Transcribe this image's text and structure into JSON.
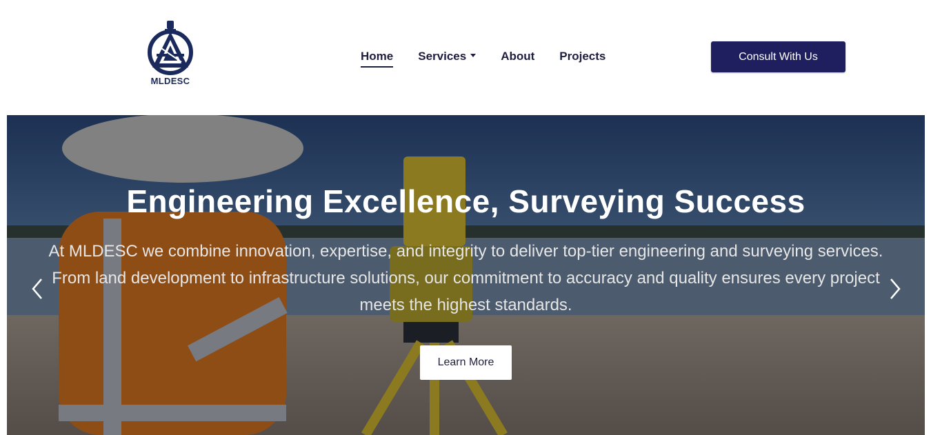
{
  "brand": {
    "name": "MLDESC",
    "color": "#1b2a5c"
  },
  "nav": {
    "items": [
      {
        "label": "Home",
        "active": true
      },
      {
        "label": "Services",
        "dropdown": true
      },
      {
        "label": "About"
      },
      {
        "label": "Projects"
      }
    ]
  },
  "cta": {
    "label": "Consult With Us",
    "color": "#1f1f5f"
  },
  "hero": {
    "title": "Engineering Excellence, Surveying Success",
    "text": "At MLDESC we combine innovation, expertise, and integrity to deliver top-tier engineering and surveying services. From land development to infrastructure solutions, our commitment to accuracy and quality ensures every project meets the highest standards.",
    "button_label": "Learn More",
    "prev_icon": "chevron-left-icon",
    "next_icon": "chevron-right-icon"
  }
}
